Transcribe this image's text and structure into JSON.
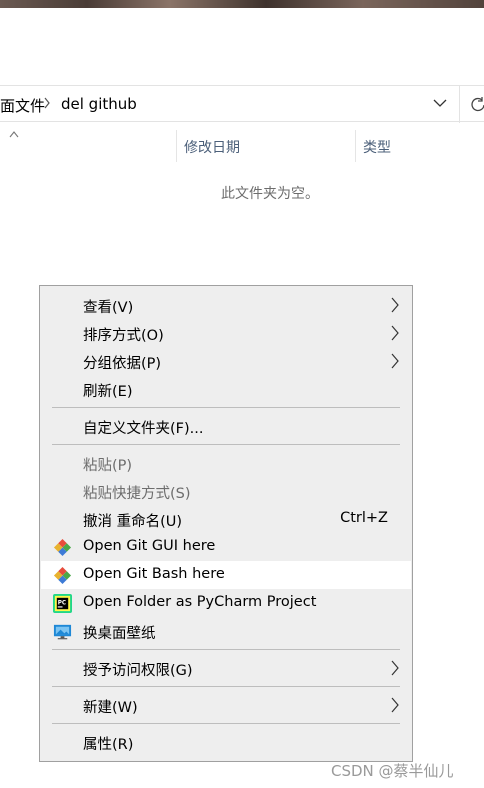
{
  "breadcrumb": {
    "parent": "面文件",
    "current": "del github"
  },
  "columns": {
    "date": "修改日期",
    "type": "类型"
  },
  "empty_message": "此文件夹为空。",
  "context_menu": {
    "view": "查看(V)",
    "sort": "排序方式(O)",
    "group": "分组依据(P)",
    "refresh": "刷新(E)",
    "customize": "自定义文件夹(F)...",
    "paste": "粘贴(P)",
    "paste_shortcut": "粘贴快捷方式(S)",
    "undo_rename": "撤消 重命名(U)",
    "undo_shortcut": "Ctrl+Z",
    "git_gui": "Open Git GUI here",
    "git_bash": "Open Git Bash here",
    "pycharm": "Open Folder as PyCharm Project",
    "wallpaper": "换桌面壁纸",
    "access": "授予访问权限(G)",
    "new": "新建(W)",
    "properties": "属性(R)"
  },
  "watermark": "CSDN @蔡半仙儿",
  "colors": {
    "menu_bg": "#eeeeee",
    "column_text": "#4c607a",
    "disabled_text": "#6d6d6d",
    "git_red": "#e74c3c",
    "git_green": "#4aa84a",
    "git_blue": "#3d7bd6",
    "git_yellow": "#e8b22f"
  }
}
